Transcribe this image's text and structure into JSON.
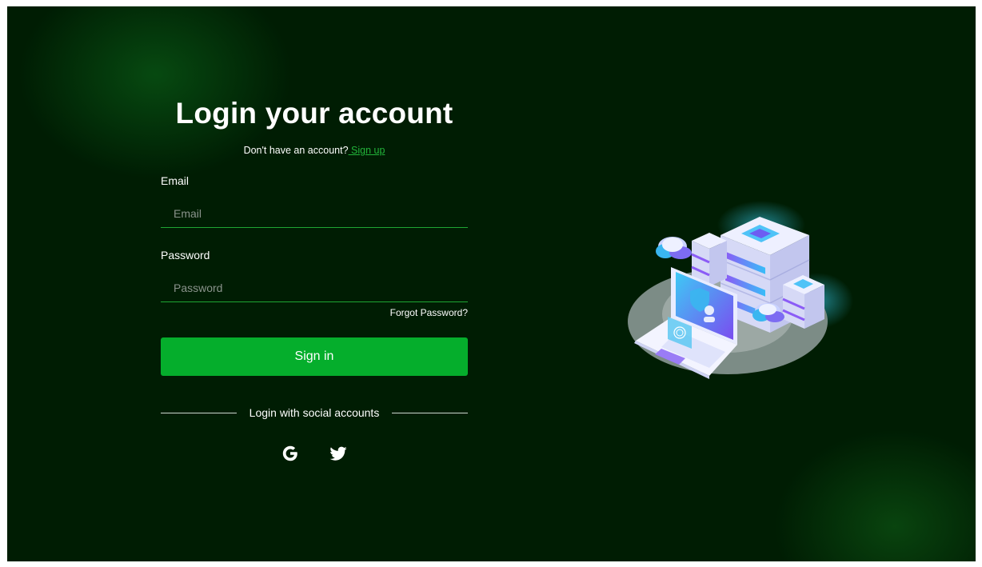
{
  "login": {
    "title": "Login your account",
    "no_account_text": "Don't have an account?",
    "signup_link": " Sign up",
    "email_label": "Email",
    "email_placeholder": "Email",
    "password_label": "Password",
    "password_placeholder": "Password",
    "forgot_password": "Forgot Password?",
    "signin_button": "Sign in",
    "social_label": "Login with social accounts"
  },
  "social": {
    "icons": [
      "google-icon",
      "twitter-icon"
    ]
  },
  "colors": {
    "background": "#001d03",
    "accent": "#05ae2c",
    "link": "#22b33a",
    "input_underline": "#1fa533"
  }
}
